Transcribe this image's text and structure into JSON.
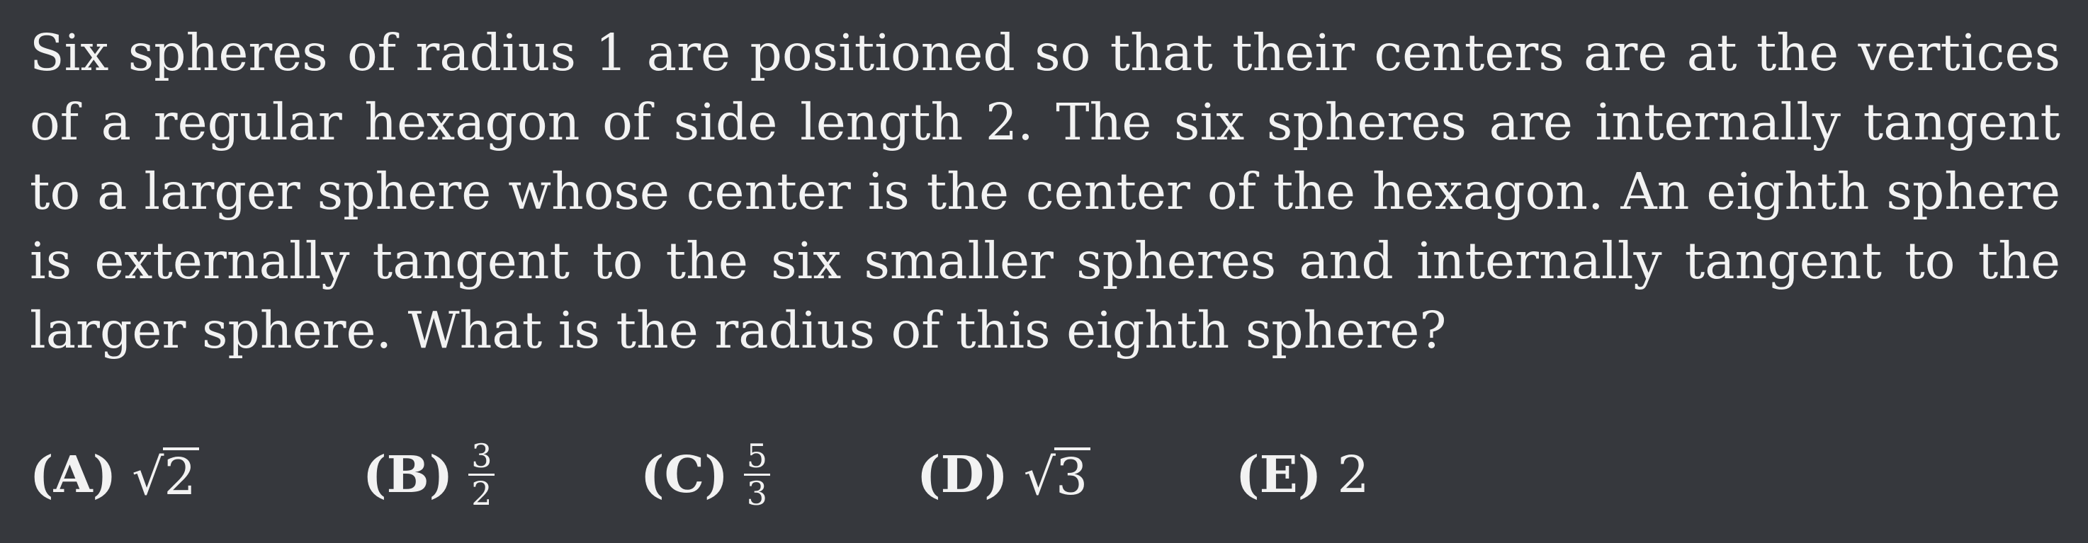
{
  "problem": {
    "lines": [
      "Six spheres of radius 1 are positioned so that their centers are at the vertices",
      "of a regular hexagon of side length 2.  The six spheres are internally tangent",
      "to a larger sphere whose center is the center of the hexagon.  An eighth sphere",
      "is externally tangent to the six smaller spheres and internally tangent to the",
      "larger sphere. What is the radius of this eighth sphere?"
    ]
  },
  "choices": [
    {
      "letter": "(A)",
      "radical": "√",
      "radicand": "2"
    },
    {
      "letter": "(B)",
      "numerator": "3",
      "denominator": "2"
    },
    {
      "letter": "(C)",
      "numerator": "5",
      "denominator": "3"
    },
    {
      "letter": "(D)",
      "radical": "√",
      "radicand": "3"
    },
    {
      "letter": "(E)",
      "value": "2"
    }
  ]
}
